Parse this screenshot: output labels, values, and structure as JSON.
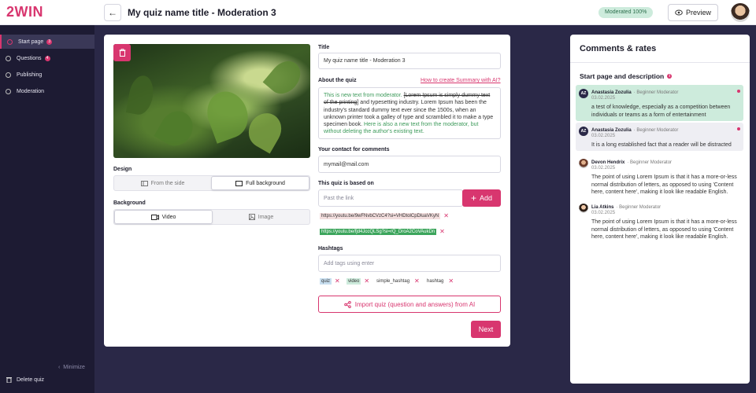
{
  "app": {
    "logo": "2WIN"
  },
  "header": {
    "title": "My quiz name title - Moderation 3",
    "status": "Moderated 100%",
    "preview_label": "Preview"
  },
  "sidebar": {
    "items": [
      {
        "label": "Start page",
        "badge": "3"
      },
      {
        "label": "Questions",
        "badge": "4"
      },
      {
        "label": "Publishing"
      },
      {
        "label": "Moderation"
      }
    ],
    "minimize_label": "Minimize",
    "delete_label": "Delete quiz"
  },
  "form": {
    "design_label": "Design",
    "design_options": [
      "From the side",
      "Full background"
    ],
    "background_label": "Background",
    "background_options": [
      "Video",
      "Image"
    ],
    "title_label": "Title",
    "title_value": "My quiz name title - Moderation 3",
    "about_label": "About the quiz",
    "about_link": "How to create Summary with AI?",
    "about": {
      "p1": "This is new text from moderator. ",
      "p2_strike": "[Lorem Ipsum is simply dummy text of the printing",
      "p3": "] and typesetting industry. Lorem Ipsum has been the industry's standard dummy text ever since the 1500s, when an unknown printer took a galley of type and scrambled it to make a type specimen book. ",
      "p4": "Here is also a new text from the moderator, but without deleting the author's existing text."
    },
    "contact_label": "Your contact for comments",
    "contact_value": "mymail@mail.com",
    "based_label": "This quiz is based on",
    "based_placeholder": "Past the link",
    "add_label": "Add",
    "links": [
      "https://youtu.be/9wFNvbCVzC4?si=VHDtolCpDluaVKyN",
      "https://youtu.be/fjd4JccQLSg?si=rQ_DroA2CoVAukDn"
    ],
    "hashtags_label": "Hashtags",
    "hashtags_placeholder": "Add tags using enter",
    "tags": [
      "quiz",
      "video",
      "simple_hashtag",
      "hashtag"
    ],
    "import_label": "Import quiz (question and answers) from AI",
    "next_label": "Next"
  },
  "comments": {
    "title": "Comments & rates",
    "section": "Start page and description",
    "items": [
      {
        "initials": "AZ",
        "name": "Anastasia Zozulia",
        "role": "· Beginner Moderator",
        "date": "03.02.2025",
        "text": "a test of knowledge, especially as a competition between individuals or teams as a form of entertainment"
      },
      {
        "initials": "AZ",
        "name": "Anastasia Zozulia",
        "role": "· Beginner Moderator",
        "date": "03.02.2025",
        "text": "It is a long established fact that a reader will be distracted"
      },
      {
        "initials": "",
        "name": "Devon Hendrix",
        "role": "· Beginner Moderator",
        "date": "03.02.2025",
        "text": "The point of using Lorem Ipsum is that it has a more-or-less normal distribution of letters, as opposed to using 'Content here, content here', making it look like readable English."
      },
      {
        "initials": "",
        "name": "Lia Atkins",
        "role": "· Beginner Moderator",
        "date": "03.02.2025",
        "text": "The point of using Lorem Ipsum is that it has a more-or-less normal distribution of letters, as opposed to using 'Content here, content here', making it look like readable English."
      }
    ]
  },
  "colors": {
    "accent": "#d8366f",
    "sidebar": "#1d1b33",
    "background": "#2a2847",
    "success": "#cdebdc"
  }
}
